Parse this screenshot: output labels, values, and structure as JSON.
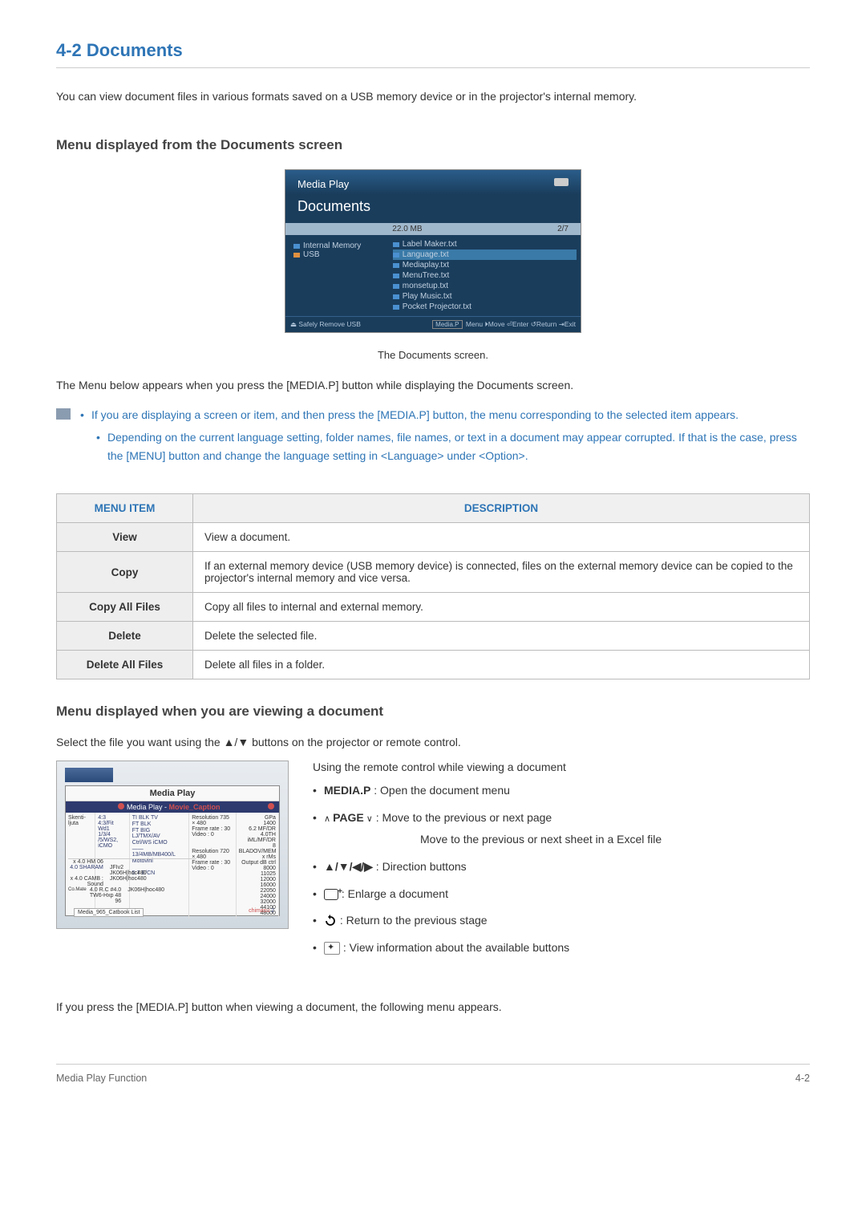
{
  "page_title": "4-2   Documents",
  "intro": "You can view document files in various formats saved on a USB memory device or in the projector's internal memory.",
  "section1_title": "Menu displayed from the Documents screen",
  "ss1": {
    "top": "Media Play",
    "title": "Documents",
    "size": "22.0 MB",
    "page": "2/7",
    "left": {
      "internal": "Internal Memory",
      "usb": "USB"
    },
    "files": [
      "Label Maker.txt",
      "Language.txt",
      "Mediaplay.txt",
      "MenuTree.txt",
      "monsetup.txt",
      "Play Music.txt",
      "Pocket Projector.txt"
    ],
    "footer_left": "Safely Remove USB",
    "footer_right_tag": "Media.P",
    "footer_right": "Menu  ⏵Move  ⏎Enter  ↺Return  ⇥Exit"
  },
  "caption1": "The Documents screen.",
  "para1": "The Menu below appears when you press the [MEDIA.P] button while displaying the Documents screen.",
  "notes": [
    "If you are displaying a screen or item, and then press the [MEDIA.P] button, the menu corresponding to the selected item appears.",
    "Depending on the current language setting, folder names, file names, or text in a document may appear corrupted. If that is the case, press the [MENU] button and change the language setting in <Language> under <Option>."
  ],
  "table": {
    "headers": [
      "MENU ITEM",
      "DESCRIPTION"
    ],
    "rows": [
      {
        "item": "View",
        "desc": "View a document."
      },
      {
        "item": "Copy",
        "desc": "If an external memory device (USB memory device) is connected, files on the external memory device can be copied to the projector's internal memory and vice versa."
      },
      {
        "item": "Copy All Files",
        "desc": "Copy all files to internal and external memory."
      },
      {
        "item": "Delete",
        "desc": "Delete the selected file."
      },
      {
        "item": "Delete All Files",
        "desc": "Delete all files in a folder."
      }
    ]
  },
  "section2_title": "Menu displayed when you are viewing a document",
  "subpara2": "Select the file you want using the ▲/▼ buttons on the projector or remote control.",
  "ss2": {
    "title": "Media Play",
    "bar": "Media Play",
    "bar_red": "Movie_Caption"
  },
  "remote": {
    "title": "Using the remote control while viewing a document",
    "mediap_label": "MEDIA.P",
    "mediap_desc": " : Open the document menu",
    "page_prefix": "∧ ",
    "page_label": "PAGE",
    "page_suffix": " ∨",
    "page_desc": " :    Move to the previous or next page",
    "page_sub": "Move to the previous or next sheet in a Excel file",
    "dir_label": "▲/▼/◀/▶",
    "dir_desc": " : Direction buttons",
    "enlarge_desc": " : Enlarge a document",
    "return_desc": " : Return to the previous stage",
    "info_desc": " : View information about the available buttons"
  },
  "para_last": "If you press the [MEDIA.P] button when viewing a document, the following menu appears.",
  "footer_left": "Media Play Function",
  "footer_right": "4-2"
}
